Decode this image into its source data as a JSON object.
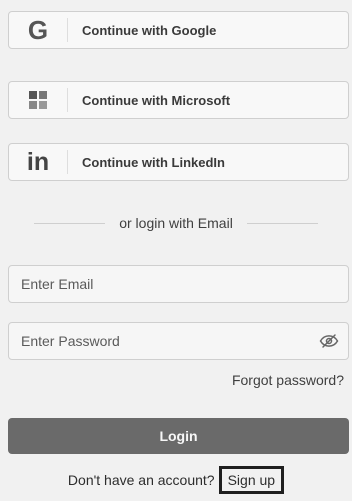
{
  "auth": {
    "providers": [
      {
        "name": "google",
        "label": "Continue with Google",
        "icon": "google-icon",
        "icon_text": "G"
      },
      {
        "name": "microsoft",
        "label": "Continue with Microsoft",
        "icon": "microsoft-icon"
      },
      {
        "name": "linkedin",
        "label": "Continue with LinkedIn",
        "icon": "linkedin-icon",
        "icon_text": "in"
      }
    ],
    "divider": "or login with Email",
    "email_placeholder": "Enter Email",
    "password_placeholder": "Enter Password",
    "forgot_password": "Forgot password?",
    "login_button": "Login",
    "signup_prompt": "Don't have an account?",
    "signup_link": "Sign up"
  },
  "colors": {
    "page_background": "#f1f1f1",
    "button_border": "#cfcfcf",
    "login_button": "#6a6a6a",
    "highlight_border": "#1f1f1f"
  }
}
